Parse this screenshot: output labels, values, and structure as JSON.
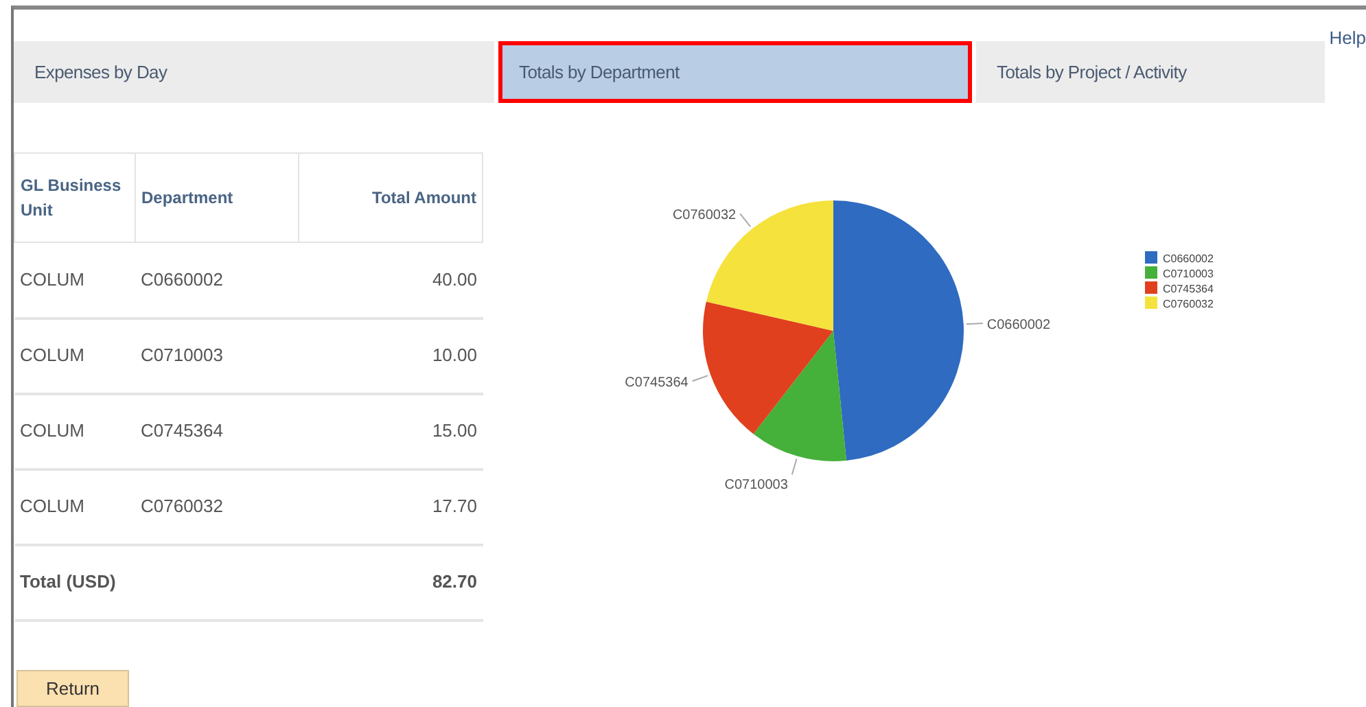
{
  "help_link": "Help",
  "tabs": [
    {
      "label": "Expenses by Day",
      "selected": false,
      "highlighted": false
    },
    {
      "label": "Totals by Department",
      "selected": true,
      "highlighted": true
    },
    {
      "label": "Totals by Project / Activity",
      "selected": false,
      "highlighted": false
    }
  ],
  "table": {
    "columns": [
      "GL Business Unit",
      "Department",
      "Total Amount"
    ],
    "rows": [
      [
        "COLUM",
        "C0660002",
        "40.00"
      ],
      [
        "COLUM",
        "C0710003",
        "10.00"
      ],
      [
        "COLUM",
        "C0745364",
        "15.00"
      ],
      [
        "COLUM",
        "C0760032",
        "17.70"
      ]
    ],
    "total": {
      "label": "Total (USD)",
      "amount": "82.70"
    }
  },
  "chart_data": {
    "type": "pie",
    "categories": [
      "C0660002",
      "C0710003",
      "C0745364",
      "C0760032"
    ],
    "series": [
      {
        "values": [
          48.4,
          12.1,
          18.1,
          21.4
        ],
        "colors": [
          "#2f6bc0",
          "#45b03a",
          "#e0401e",
          "#f5e23c"
        ]
      }
    ],
    "legend": true
  },
  "buttons": [
    {
      "label": "Return"
    }
  ]
}
